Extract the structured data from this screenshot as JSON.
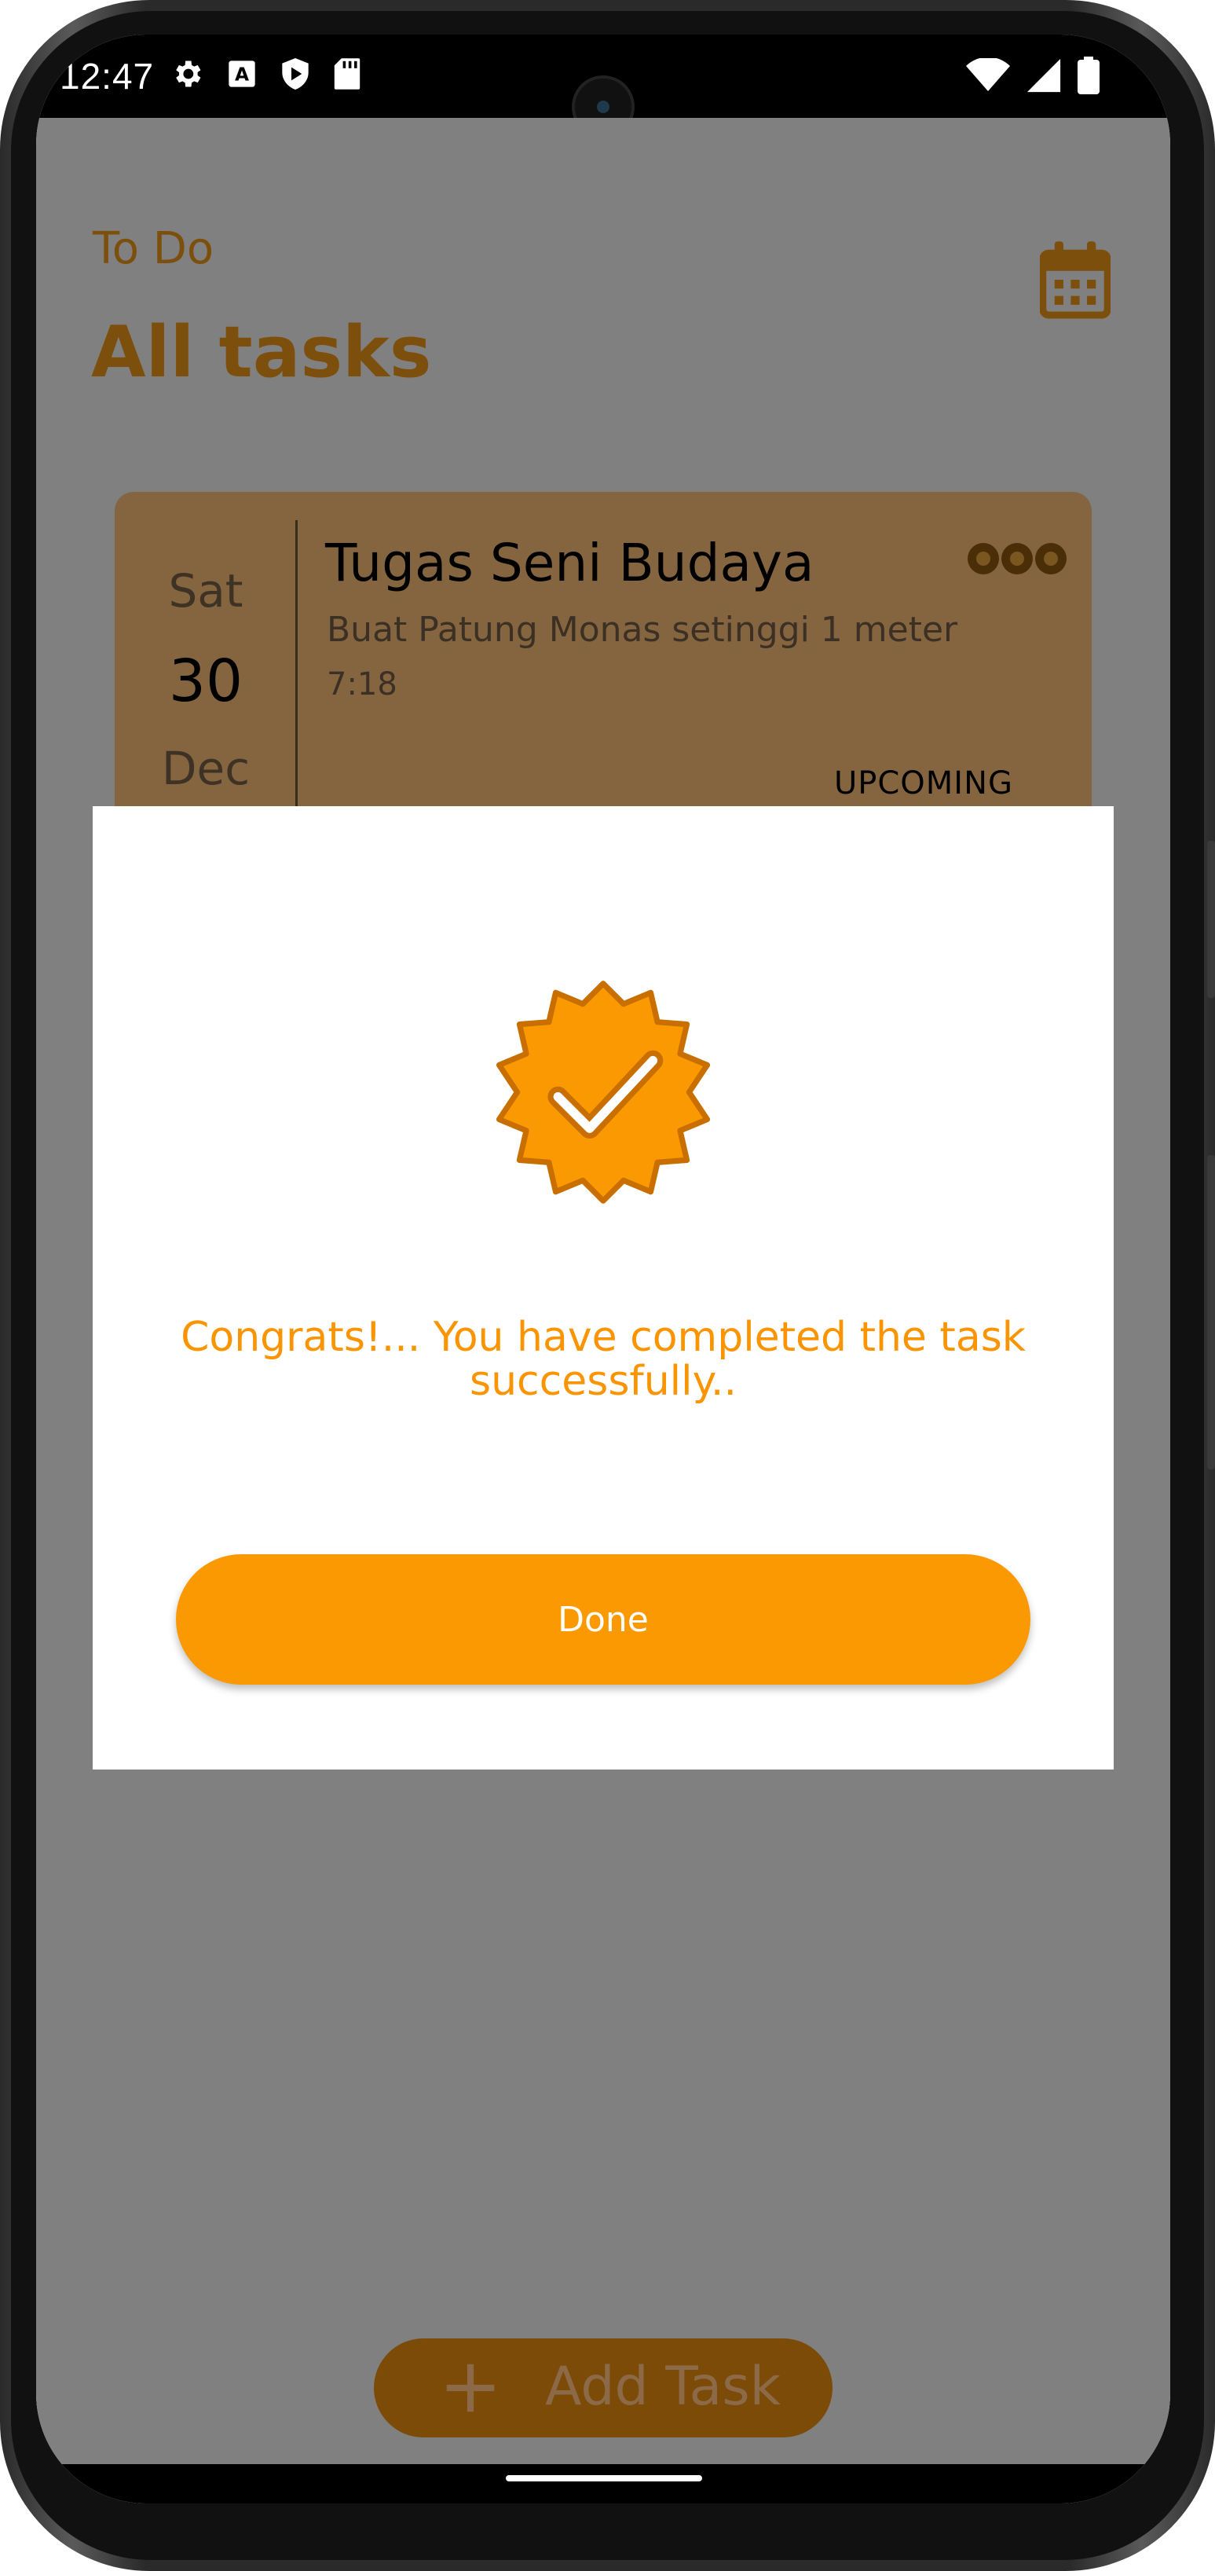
{
  "status_bar": {
    "time": "12:47",
    "icons_left": [
      "settings-gear-icon",
      "font-a-icon",
      "shield-play-icon",
      "sd-card-icon"
    ],
    "icons_right": [
      "wifi-icon",
      "signal-icon",
      "battery-icon"
    ]
  },
  "header": {
    "subtitle": "To Do",
    "title": "All tasks",
    "calendar_icon": "calendar-icon"
  },
  "task_card": {
    "day_of_week": "Sat",
    "day": "30",
    "month": "Dec",
    "title": "Tugas Seni Budaya",
    "description": "Buat Patung Monas setinggi 1 meter",
    "time": "7:18",
    "status": "UPCOMING",
    "menu_icon": "more-options-icon"
  },
  "dialog": {
    "badge_icon": "verified-check-badge-icon",
    "message": "Congrats!... You have completed the task successfully..",
    "done_label": "Done"
  },
  "fab": {
    "label": "Add Task",
    "icon": "plus-icon"
  },
  "colors": {
    "accent": "#fa9400",
    "button": "#fb9902",
    "card": "#84653f",
    "overlay": "#808080",
    "title_dim": "#7d4f0c"
  }
}
